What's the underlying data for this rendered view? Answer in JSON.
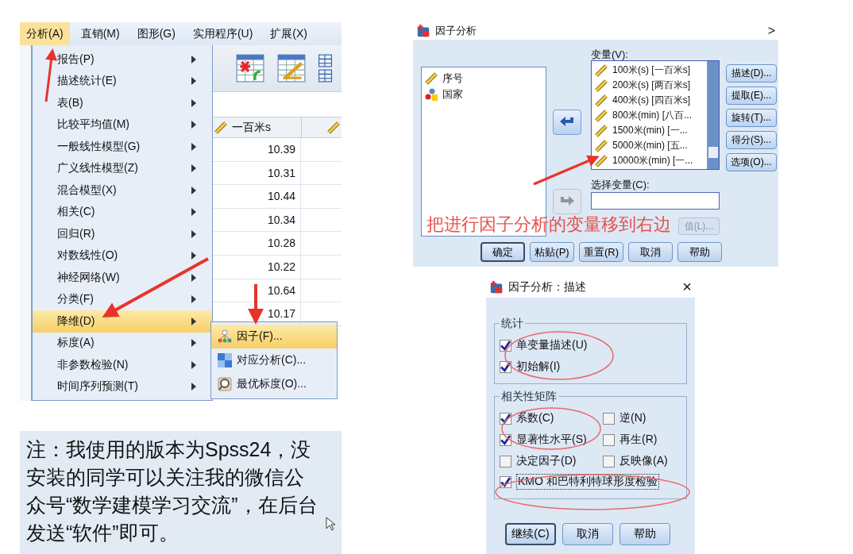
{
  "spss_screenshot": {
    "menubar": [
      {
        "label": "分析(A)",
        "selected": true
      },
      {
        "label": "直销(M)",
        "selected": false
      },
      {
        "label": "图形(G)",
        "selected": false
      },
      {
        "label": "实用程序(U)",
        "selected": false
      },
      {
        "label": "扩展(X)",
        "selected": false
      }
    ],
    "menu_items": [
      {
        "label": "报告(P)",
        "selected": false
      },
      {
        "label": "描述统计(E)",
        "selected": false
      },
      {
        "label": "表(B)",
        "selected": false
      },
      {
        "label": "比较平均值(M)",
        "selected": false
      },
      {
        "label": "一般线性模型(G)",
        "selected": false
      },
      {
        "label": "广义线性模型(Z)",
        "selected": false
      },
      {
        "label": "混合模型(X)",
        "selected": false
      },
      {
        "label": "相关(C)",
        "selected": false
      },
      {
        "label": "回归(R)",
        "selected": false
      },
      {
        "label": "对数线性(O)",
        "selected": false
      },
      {
        "label": "神经网络(W)",
        "selected": false
      },
      {
        "label": "分类(F)",
        "selected": false
      },
      {
        "label": "降维(D)",
        "selected": true
      },
      {
        "label": "标度(A)",
        "selected": false
      },
      {
        "label": "非参数检验(N)",
        "selected": false
      },
      {
        "label": "时间序列预测(T)",
        "selected": false
      }
    ],
    "submenu_items": [
      {
        "label": "因子(F)...",
        "selected": true,
        "kind": "factor"
      },
      {
        "label": "对应分析(C)...",
        "selected": false,
        "kind": "correspondence"
      },
      {
        "label": "最优标度(O)...",
        "selected": false,
        "kind": "optimal"
      }
    ],
    "data_column": {
      "header": "一百米s",
      "values": [
        "10.39",
        "10.31",
        "10.44",
        "10.34",
        "10.28",
        "10.22",
        "10.64",
        "10.17"
      ]
    }
  },
  "note": "注：我使用的版本为Spss24，没安装的同学可以关注我的微信公众号“数学建模学习交流”，在后台发送“软件”即可。",
  "factor_dialog": {
    "title": "因子分析",
    "expand_glyph": ">",
    "source_variables": [
      {
        "name": "序号",
        "kind": "scale"
      },
      {
        "name": "国家",
        "kind": "nominal"
      }
    ],
    "variables_label": "变量(V):",
    "variables": [
      "100米(s) [一百米s]",
      "200米(s) [两百米s]",
      "400米(s) [四百米s]",
      "800米(min) [八百...",
      "1500米(min) [一...",
      "5000米(min) [五...",
      "10000米(min) [一..."
    ],
    "side_buttons": [
      "描述(D)...",
      "提取(E)...",
      "旋转(T)...",
      "得分(S)...",
      "选项(O)..."
    ],
    "selection_label": "选择变量(C):",
    "value_button": {
      "label": "值(L)...",
      "disabled": true
    },
    "bottom_buttons": [
      {
        "label": "确定",
        "default": true
      },
      {
        "label": "粘贴(P)",
        "default": false
      },
      {
        "label": "重置(R)",
        "default": false
      },
      {
        "label": "取消",
        "default": false
      },
      {
        "label": "帮助",
        "default": false
      }
    ]
  },
  "annotation_text": "把进行因子分析的变量移到右边",
  "descriptives_dialog": {
    "title": "因子分析：描述",
    "close_glyph": "×",
    "groups": [
      {
        "title": "统计",
        "options": [
          {
            "label": "单变量描述(U)",
            "checked": true
          },
          {
            "label": "初始解(I)",
            "checked": true
          }
        ]
      },
      {
        "title": "相关性矩阵",
        "options": [
          {
            "label": "系数(C)",
            "checked": true
          },
          {
            "label": "逆(N)",
            "checked": false
          },
          {
            "label": "显著性水平(S)",
            "checked": true
          },
          {
            "label": "再生(R)",
            "checked": false
          },
          {
            "label": "决定因子(D)",
            "checked": false
          },
          {
            "label": "反映像(A)",
            "checked": false
          }
        ]
      }
    ],
    "kmo_option": {
      "label": "KMO 和巴特利特球形度检验",
      "checked": true
    },
    "buttons": [
      {
        "label": "继续(C)",
        "default": true
      },
      {
        "label": "取消",
        "default": false
      },
      {
        "label": "帮助",
        "default": false
      }
    ]
  }
}
